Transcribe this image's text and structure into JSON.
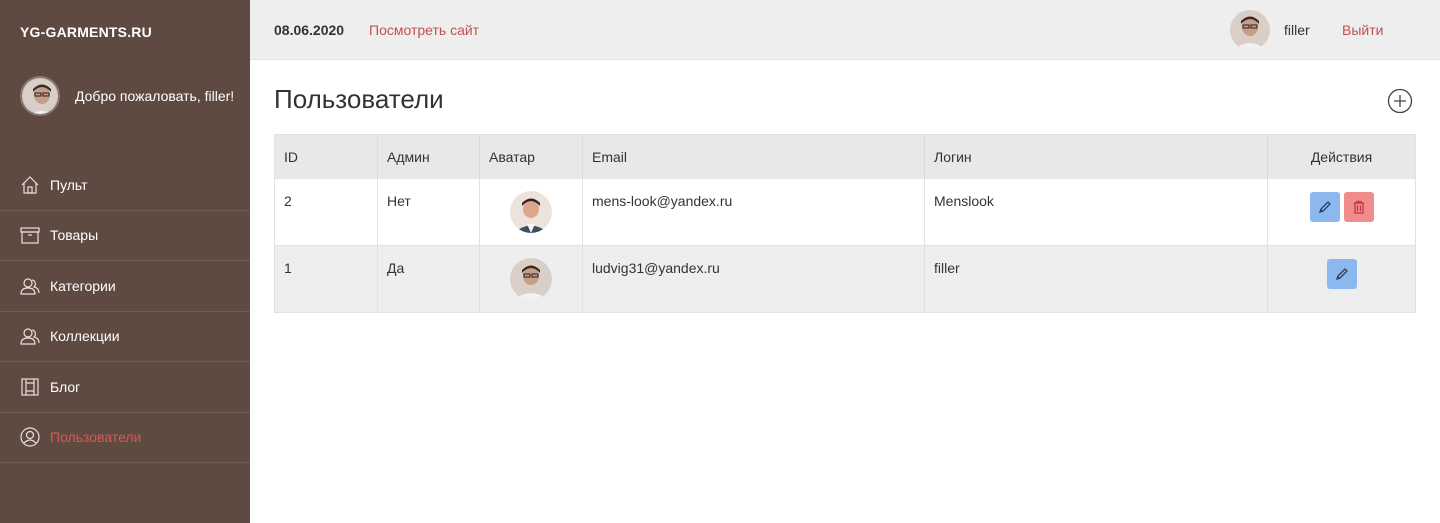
{
  "sidebar": {
    "brand": "YG-GARMENTS.RU",
    "welcome": "Добро пожаловать, filler!",
    "items": [
      {
        "label": "Пульт",
        "icon": "home-icon",
        "active": false
      },
      {
        "label": "Товары",
        "icon": "box-icon",
        "active": false
      },
      {
        "label": "Категории",
        "icon": "users-icon",
        "active": false
      },
      {
        "label": "Коллекции",
        "icon": "users-icon",
        "active": false
      },
      {
        "label": "Блог",
        "icon": "book-icon",
        "active": false
      },
      {
        "label": "Пользователи",
        "icon": "user-icon",
        "active": true
      }
    ]
  },
  "topbar": {
    "date": "08.06.2020",
    "view_site": "Посмотреть сайт",
    "user_name": "filler",
    "logout": "Выйти"
  },
  "main": {
    "title": "Пользователи",
    "add_icon": "plus-circle-icon",
    "table": {
      "headers": [
        "ID",
        "Админ",
        "Аватар",
        "Email",
        "Логин",
        "Действия"
      ],
      "rows": [
        {
          "id": "2",
          "admin": "Нет",
          "email": "mens-look@yandex.ru",
          "login": "Menslook",
          "actions": [
            "edit",
            "delete"
          ]
        },
        {
          "id": "1",
          "admin": "Да",
          "email": "ludvig31@yandex.ru",
          "login": "filler",
          "actions": [
            "edit"
          ]
        }
      ]
    }
  },
  "colors": {
    "sidebar_bg": "#5e4a40",
    "accent_red": "#c0504d",
    "edit_button": "#8cb8f0",
    "delete_button": "#f28b8b"
  }
}
